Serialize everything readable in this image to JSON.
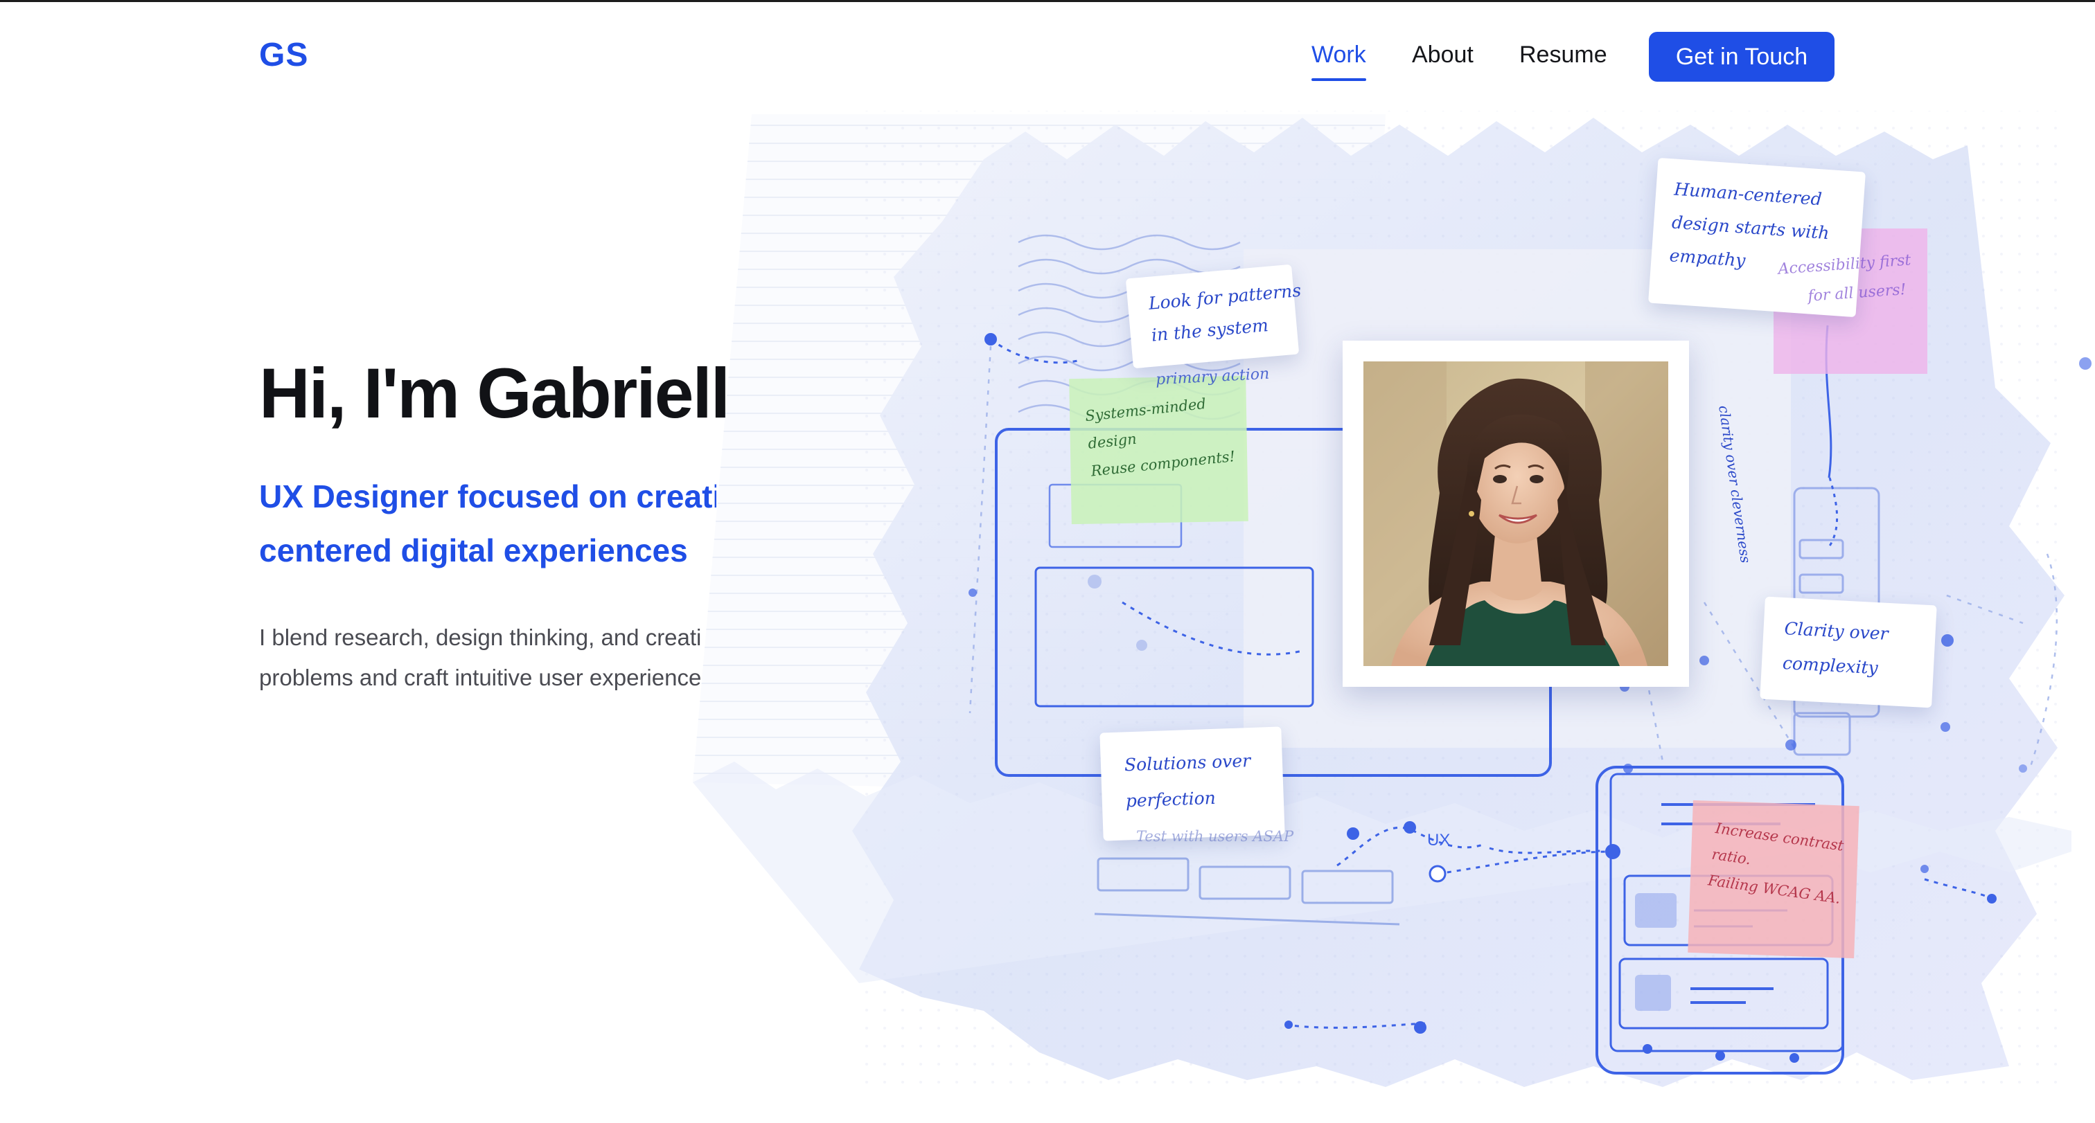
{
  "header": {
    "logo": "GS",
    "nav": {
      "work": "Work",
      "about": "About",
      "resume": "Resume"
    },
    "cta_label": "Get in Touch"
  },
  "hero": {
    "title": "Hi, I'm Gabrielle",
    "subtitle_line1": "UX Designer focused on creati",
    "subtitle_line2": "centered digital experiences",
    "desc_line1": "I blend research, design thinking, and creati",
    "desc_line2": "problems and craft intuitive user experience"
  },
  "notes": {
    "human": [
      "Human-centered",
      "design starts with",
      "empathy"
    ],
    "patterns": [
      "Look for patterns",
      "in the system"
    ],
    "primary": "primary action",
    "systems": [
      "Systems-minded",
      "design",
      "Reuse components!"
    ],
    "accessibility": [
      "Accessibility first",
      "for all users!"
    ],
    "clarity_vertical": "clarity over cleverness",
    "clarity": [
      "Clarity over",
      "complexity"
    ],
    "solutions": [
      "Solutions over",
      "perfection"
    ],
    "test_users": "Test with users ASAP",
    "contrast": [
      "Increase contrast",
      "ratio.",
      "Failing WCAG AA."
    ],
    "ux_label": "UX"
  },
  "colors": {
    "brand": "#1f4ee6",
    "heading": "#111216",
    "body": "#4a4b52",
    "sticky_green": "#c9f2b8",
    "sticky_pink": "#efb3ea",
    "sticky_red": "#f6b3b8"
  },
  "icons": {
    "photo": "portrait-photo"
  }
}
